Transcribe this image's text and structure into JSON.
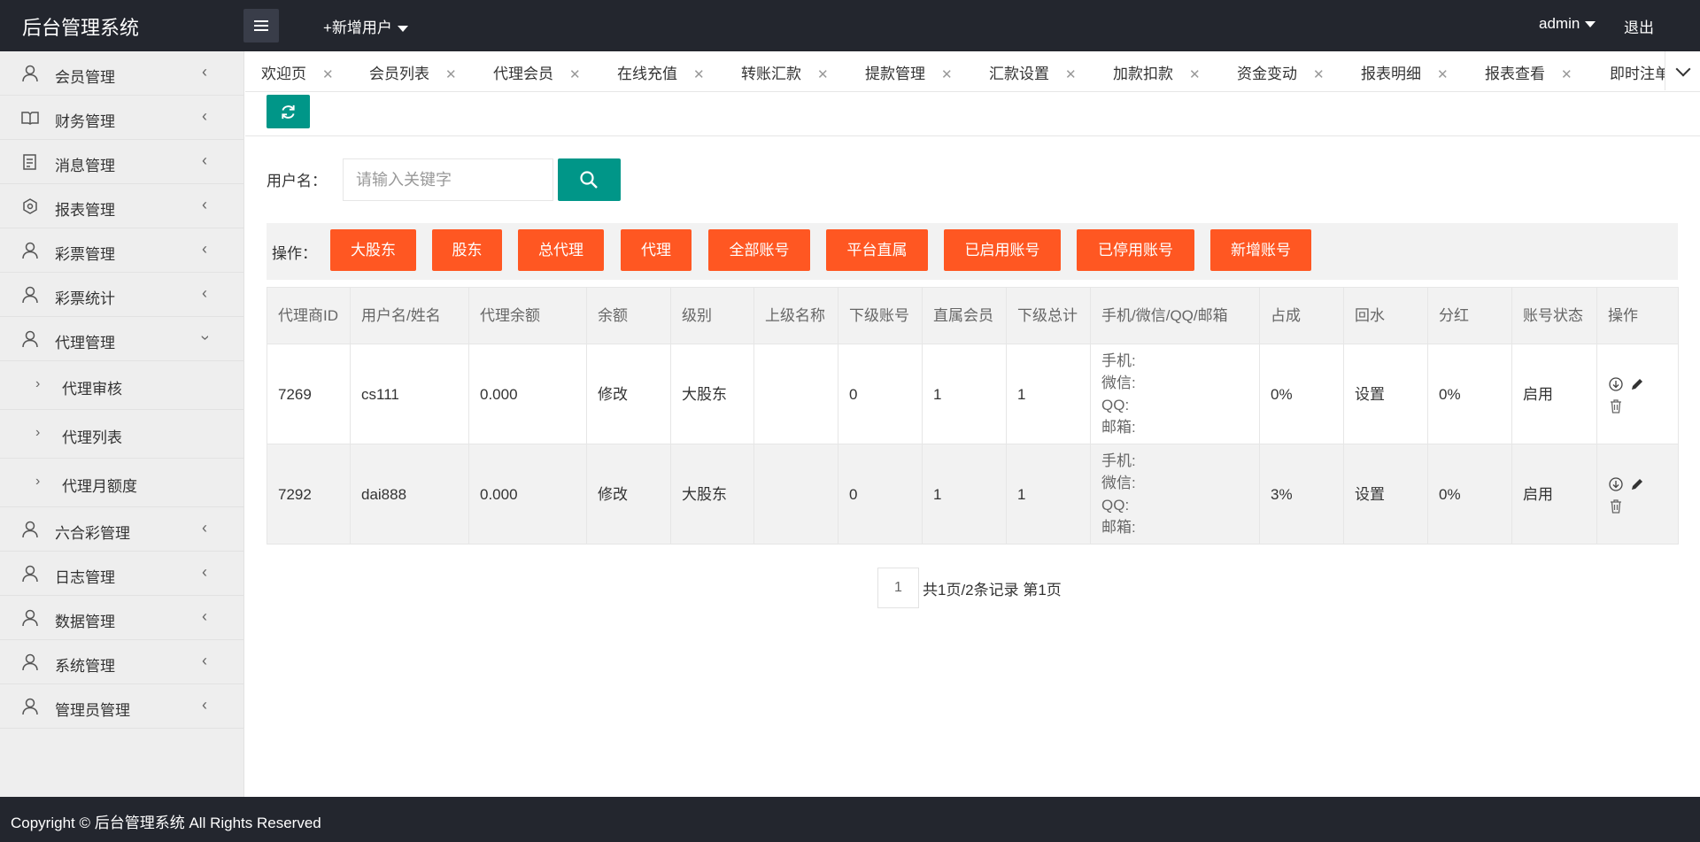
{
  "header": {
    "logo": "后台管理系统",
    "add_user": "+新增用户",
    "user": "admin",
    "logout": "退出"
  },
  "sidebar": {
    "items": [
      {
        "label": "会员管理",
        "icon": "user-icon"
      },
      {
        "label": "财务管理",
        "icon": "book-icon"
      },
      {
        "label": "消息管理",
        "icon": "document-icon"
      },
      {
        "label": "报表管理",
        "icon": "report-icon"
      },
      {
        "label": "彩票管理",
        "icon": "user-icon"
      },
      {
        "label": "彩票统计",
        "icon": "user-icon"
      },
      {
        "label": "代理管理",
        "icon": "user-icon",
        "expanded": true
      }
    ],
    "sub_items": [
      "代理审核",
      "代理列表",
      "代理月额度"
    ],
    "items_after": [
      {
        "label": "六合彩管理",
        "icon": "user-icon"
      },
      {
        "label": "日志管理",
        "icon": "user-icon"
      },
      {
        "label": "数据管理",
        "icon": "user-icon"
      },
      {
        "label": "系统管理",
        "icon": "user-icon"
      },
      {
        "label": "管理员管理",
        "icon": "user-icon"
      }
    ]
  },
  "tabs": [
    "欢迎页",
    "会员列表",
    "代理会员",
    "在线充值",
    "转账汇款",
    "提款管理",
    "汇款设置",
    "加款扣款",
    "资金变动",
    "报表明细",
    "报表查看",
    "即时注单"
  ],
  "search": {
    "label": "用户名：",
    "placeholder": "请输入关键字"
  },
  "actions": {
    "label": "操作：",
    "buttons": [
      "大股东",
      "股东",
      "总代理",
      "代理",
      "全部账号",
      "平台直属",
      "已启用账号",
      "已停用账号",
      "新增账号"
    ]
  },
  "table": {
    "headers": [
      "代理商ID",
      "用户名/姓名",
      "代理余额",
      "余额",
      "级别",
      "上级名称",
      "下级账号",
      "直属会员",
      "下级总计",
      "手机/微信/QQ/邮箱",
      "占成",
      "回水",
      "分红",
      "账号状态",
      "操作"
    ],
    "rows": [
      {
        "id": "7269",
        "username": "cs111",
        "agent_balance": "0.000",
        "balance": "修改",
        "level": "大股东",
        "parent": "",
        "sub_accounts": "0",
        "direct_members": "1",
        "sub_total": "1",
        "contacts": [
          "手机:",
          "微信:",
          "QQ:",
          "邮箱:"
        ],
        "share": "0%",
        "rebate": "设置",
        "dividend": "0%",
        "status": "启用"
      },
      {
        "id": "7292",
        "username": "dai888",
        "agent_balance": "0.000",
        "balance": "修改",
        "level": "大股东",
        "parent": "",
        "sub_accounts": "0",
        "direct_members": "1",
        "sub_total": "1",
        "contacts": [
          "手机:",
          "微信:",
          "QQ:",
          "邮箱:"
        ],
        "share": "3%",
        "rebate": "设置",
        "dividend": "0%",
        "status": "启用"
      }
    ]
  },
  "pagination": {
    "current": "1",
    "info": "共1页/2条记录 第1页"
  },
  "footer": {
    "copyright": "Copyright © 后台管理系统 All Rights Reserved"
  },
  "colors": {
    "header_bg": "#23262e",
    "primary": "#009688",
    "accent": "#ff5722"
  }
}
